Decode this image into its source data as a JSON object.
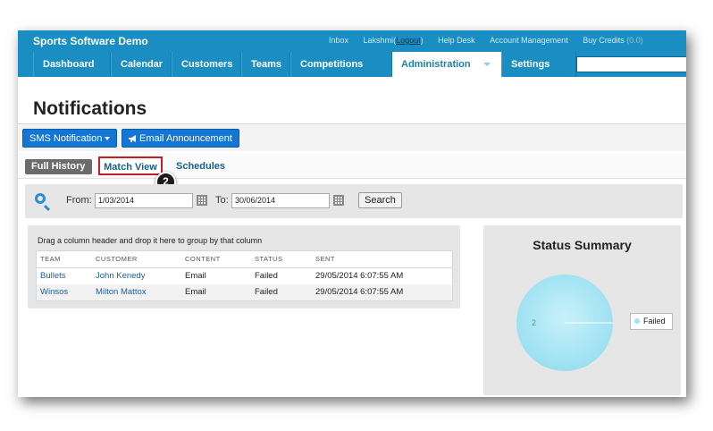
{
  "header": {
    "brand": "Sports Software Demo",
    "links": {
      "inbox": "Inbox",
      "user": "Lakshmi",
      "logout": "Logout",
      "helpdesk": "Help Desk",
      "account": "Account Management",
      "buy_credits": "Buy Credits",
      "credits_value": "(0.0)"
    }
  },
  "nav": {
    "dashboard": "Dashboard",
    "calendar": "Calendar",
    "customers": "Customers",
    "teams": "Teams",
    "competitions": "Competitions",
    "administration": "Administration",
    "settings": "Settings",
    "active": "Administration"
  },
  "page": {
    "title": "Notifications"
  },
  "toolbar": {
    "sms": "SMS Notification",
    "email": "Email Announcement"
  },
  "tabs": {
    "full_history": "Full History",
    "match_view": "Match View",
    "schedules": "Schedules",
    "step_number": "2"
  },
  "filter": {
    "from_label": "From:",
    "from_value": "1/03/2014",
    "to_label": "To:",
    "to_value": "30/06/2014",
    "search_button": "Search"
  },
  "grid": {
    "group_hint": "Drag a column header and drop it here to group by that column",
    "columns": [
      "TEAM",
      "CUSTOMER",
      "CONTENT",
      "STATUS",
      "SENT"
    ],
    "rows": [
      [
        "Bullets",
        "John Kenedy",
        "Email",
        "Failed",
        "29/05/2014 6:07:55 AM"
      ],
      [
        "Winsos",
        "Milton Mattox",
        "Email",
        "Failed",
        "29/05/2014 6:07:55 AM"
      ]
    ]
  },
  "summary": {
    "title": "Status Summary",
    "pie_label": "2",
    "legend": "Failed"
  },
  "colors": {
    "brand_bar": "#1a8ec2",
    "button_blue": "#1476d4",
    "highlight_red": "#c01f24",
    "pie_failed": "#9fe3f2"
  }
}
